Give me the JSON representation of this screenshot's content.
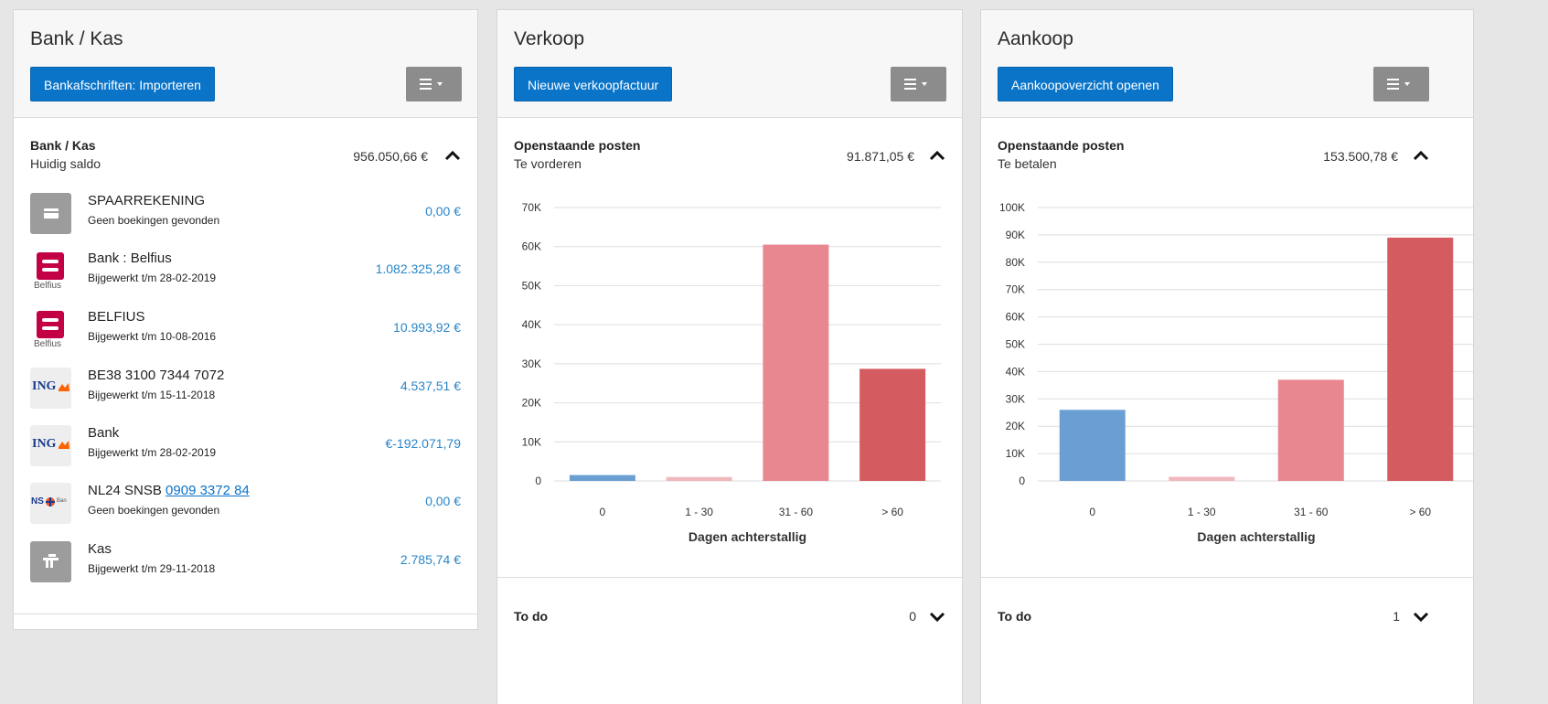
{
  "bank": {
    "title": "Bank / Kas",
    "import_button": "Bankafschriften: Importeren",
    "section_title": "Bank / Kas",
    "section_sub": "Huidig saldo",
    "section_amount": "956.050,66 €",
    "accounts": [
      {
        "name": "SPAARREKENING",
        "sub": "Geen boekingen gevonden",
        "amount": "0,00 €",
        "icon": "wallet-icon"
      },
      {
        "name": "Bank : Belfius",
        "sub": "Bijgewerkt t/m 28-02-2019",
        "amount": "1.082.325,28 €",
        "icon": "belfius-logo",
        "logo_text": "Belfius"
      },
      {
        "name": "BELFIUS",
        "sub": "Bijgewerkt t/m 10-08-2016",
        "amount": "10.993,92 €",
        "icon": "belfius-logo",
        "logo_text": "Belfius"
      },
      {
        "name": "BE38 3100 7344 7072",
        "sub": "Bijgewerkt t/m 15-11-2018",
        "amount": "4.537,51 €",
        "icon": "ing-logo",
        "logo_text": "ING"
      },
      {
        "name": "Bank",
        "sub": "Bijgewerkt t/m 28-02-2019",
        "amount": "€-192.071,79",
        "icon": "ing-logo",
        "logo_text": "ING"
      },
      {
        "name_prefix": "NL24 SNSB ",
        "name_link": "0909 3372 84",
        "sub": "Geen boekingen gevonden",
        "amount": "0,00 €",
        "icon": "sns-logo",
        "logo_text": "NS",
        "logo_small": "Ban"
      },
      {
        "name": "Kas",
        "sub": "Bijgewerkt t/m 29-11-2018",
        "amount": "2.785,74 €",
        "icon": "cash-register-icon"
      }
    ]
  },
  "verkoop": {
    "title": "Verkoop",
    "new_button": "Nieuwe verkoopfactuur",
    "section_title": "Openstaande posten",
    "section_sub": "Te vorderen",
    "section_amount": "91.871,05 €",
    "todo_title": "To do",
    "todo_count": "0"
  },
  "aankoop": {
    "title": "Aankoop",
    "open_button": "Aankoopoverzicht openen",
    "section_title": "Openstaande posten",
    "section_sub": "Te betalen",
    "section_amount": "153.500,78 €",
    "todo_title": "To do",
    "todo_count": "1"
  },
  "colors": {
    "primary": "#0a74c9",
    "bar_blue": "#6b9fd4",
    "bar_pale": "#f0b8bd",
    "bar_pink": "#e8878f",
    "bar_red": "#d45c60",
    "amount_blue": "#2a86c8"
  },
  "chart_data": [
    {
      "type": "bar",
      "categories": [
        "0",
        "1 - 30",
        "31 - 60",
        "> 60"
      ],
      "values": [
        1500,
        1000,
        60500,
        28700
      ],
      "xlabel": "Dagen achterstallig",
      "ylabel": "",
      "ylim": [
        0,
        70000
      ],
      "yticks": [
        0,
        10000,
        20000,
        30000,
        40000,
        50000,
        60000,
        70000
      ],
      "ytick_labels": [
        "0",
        "10K",
        "20K",
        "30K",
        "40K",
        "50K",
        "60K",
        "70K"
      ],
      "bar_colors": [
        "#6b9fd4",
        "#f0b8bd",
        "#e8878f",
        "#d45c60"
      ],
      "grid": true
    },
    {
      "type": "bar",
      "categories": [
        "0",
        "1 - 30",
        "31 - 60",
        "> 60"
      ],
      "values": [
        26000,
        1500,
        37000,
        89000
      ],
      "xlabel": "Dagen achterstallig",
      "ylabel": "",
      "ylim": [
        0,
        100000
      ],
      "yticks": [
        0,
        10000,
        20000,
        30000,
        40000,
        50000,
        60000,
        70000,
        80000,
        90000,
        100000
      ],
      "ytick_labels": [
        "0",
        "10K",
        "20K",
        "30K",
        "40K",
        "50K",
        "60K",
        "70K",
        "80K",
        "90K",
        "100K"
      ],
      "bar_colors": [
        "#6b9fd4",
        "#f0b8bd",
        "#e8878f",
        "#d45c60"
      ],
      "grid": true
    }
  ]
}
